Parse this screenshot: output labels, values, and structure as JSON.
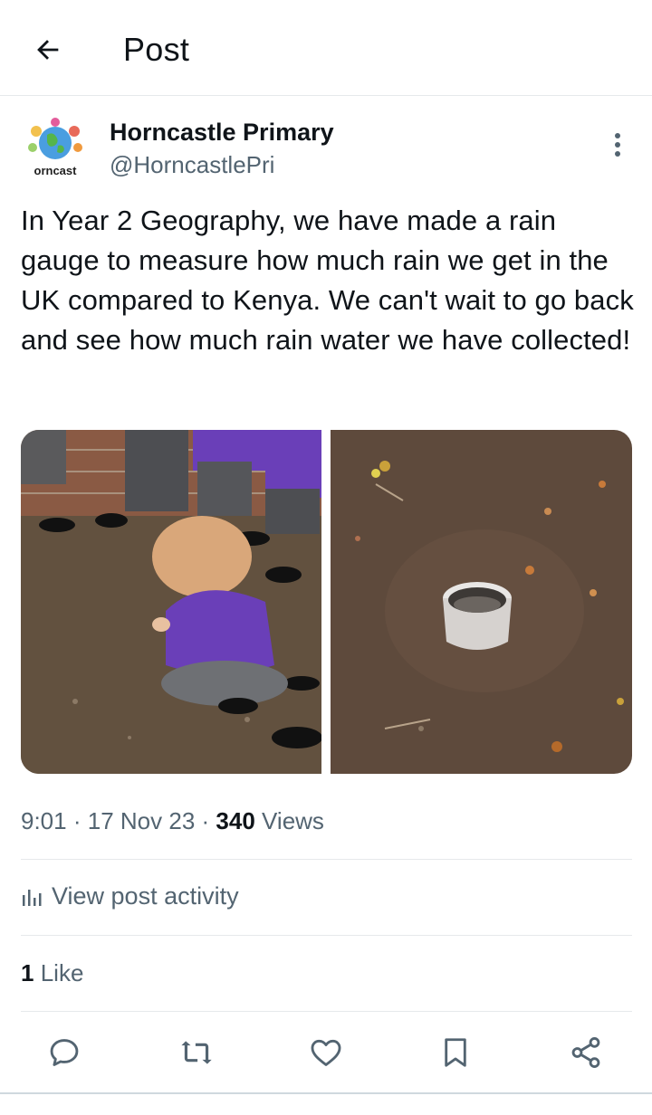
{
  "header": {
    "title": "Post"
  },
  "author": {
    "name": "Horncastle Primary",
    "handle": "@HorncastlePri",
    "avatar_text": "orncast"
  },
  "post": {
    "text": "In Year 2 Geography, we have made a rain gauge to measure how much rain we get in the UK compared to Kenya. We can't wait to go back and see how much rain water we have collected!",
    "time": "9:01",
    "date": "17 Nov 23",
    "views_count": "340",
    "views_label": "Views",
    "separator": "·"
  },
  "activity": {
    "label": "View post activity"
  },
  "likes": {
    "count": "1",
    "label": "Like"
  },
  "icons": {
    "back": "arrow-left-icon",
    "more": "vertical-dots-icon",
    "activity": "bar-chart-icon",
    "reply": "speech-bubble-icon",
    "repost": "repost-icon",
    "like": "heart-icon",
    "bookmark": "bookmark-icon",
    "share": "share-icon"
  },
  "colors": {
    "text": "#0f1419",
    "secondary": "#536471",
    "divider": "#e6e9eb",
    "purple": "#6a3fb8"
  }
}
